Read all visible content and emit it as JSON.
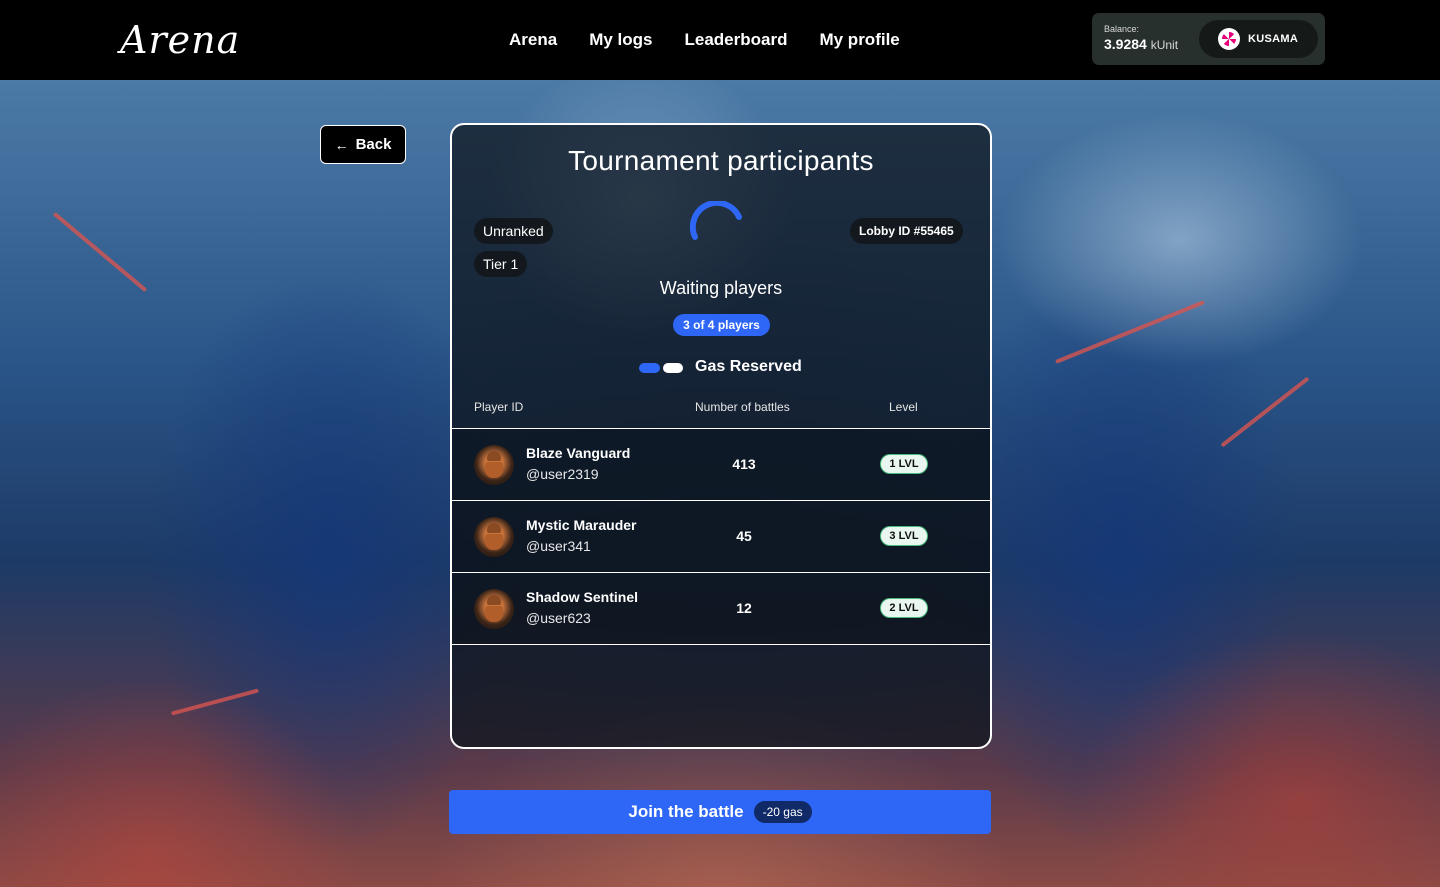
{
  "header": {
    "logo": "Arena",
    "nav": [
      {
        "label": "Arena"
      },
      {
        "label": "My logs"
      },
      {
        "label": "Leaderboard"
      },
      {
        "label": "My profile"
      }
    ],
    "wallet": {
      "label": "Balance:",
      "amount": "3.9284",
      "unit": "kUnit",
      "network": "KUSAMA",
      "network_icon": "kusama-icon"
    }
  },
  "back_button": {
    "label": "Back",
    "icon": "arrow-left-icon"
  },
  "tournament": {
    "title": "Tournament participants",
    "mode": "Unranked",
    "tier": "Tier 1",
    "lobby": "Lobby ID #55465",
    "status": "Waiting players",
    "player_count": "3 of 4 players",
    "gas_label": "Gas Reserved",
    "colors": {
      "accent": "#2e66f5",
      "level_border": "#48b97a"
    },
    "columns": {
      "player": "Player ID",
      "battles": "Number of battles",
      "level": "Level"
    },
    "players": [
      {
        "name": "Blaze Vanguard",
        "user": "@user2319",
        "battles": "413",
        "level": "1 LVL"
      },
      {
        "name": "Mystic Marauder",
        "user": "@user341",
        "battles": "45",
        "level": "3 LVL"
      },
      {
        "name": "Shadow Sentinel",
        "user": "@user623",
        "battles": "12",
        "level": "2 LVL"
      }
    ]
  },
  "join": {
    "label": "Join the battle",
    "cost": "-20 gas"
  }
}
